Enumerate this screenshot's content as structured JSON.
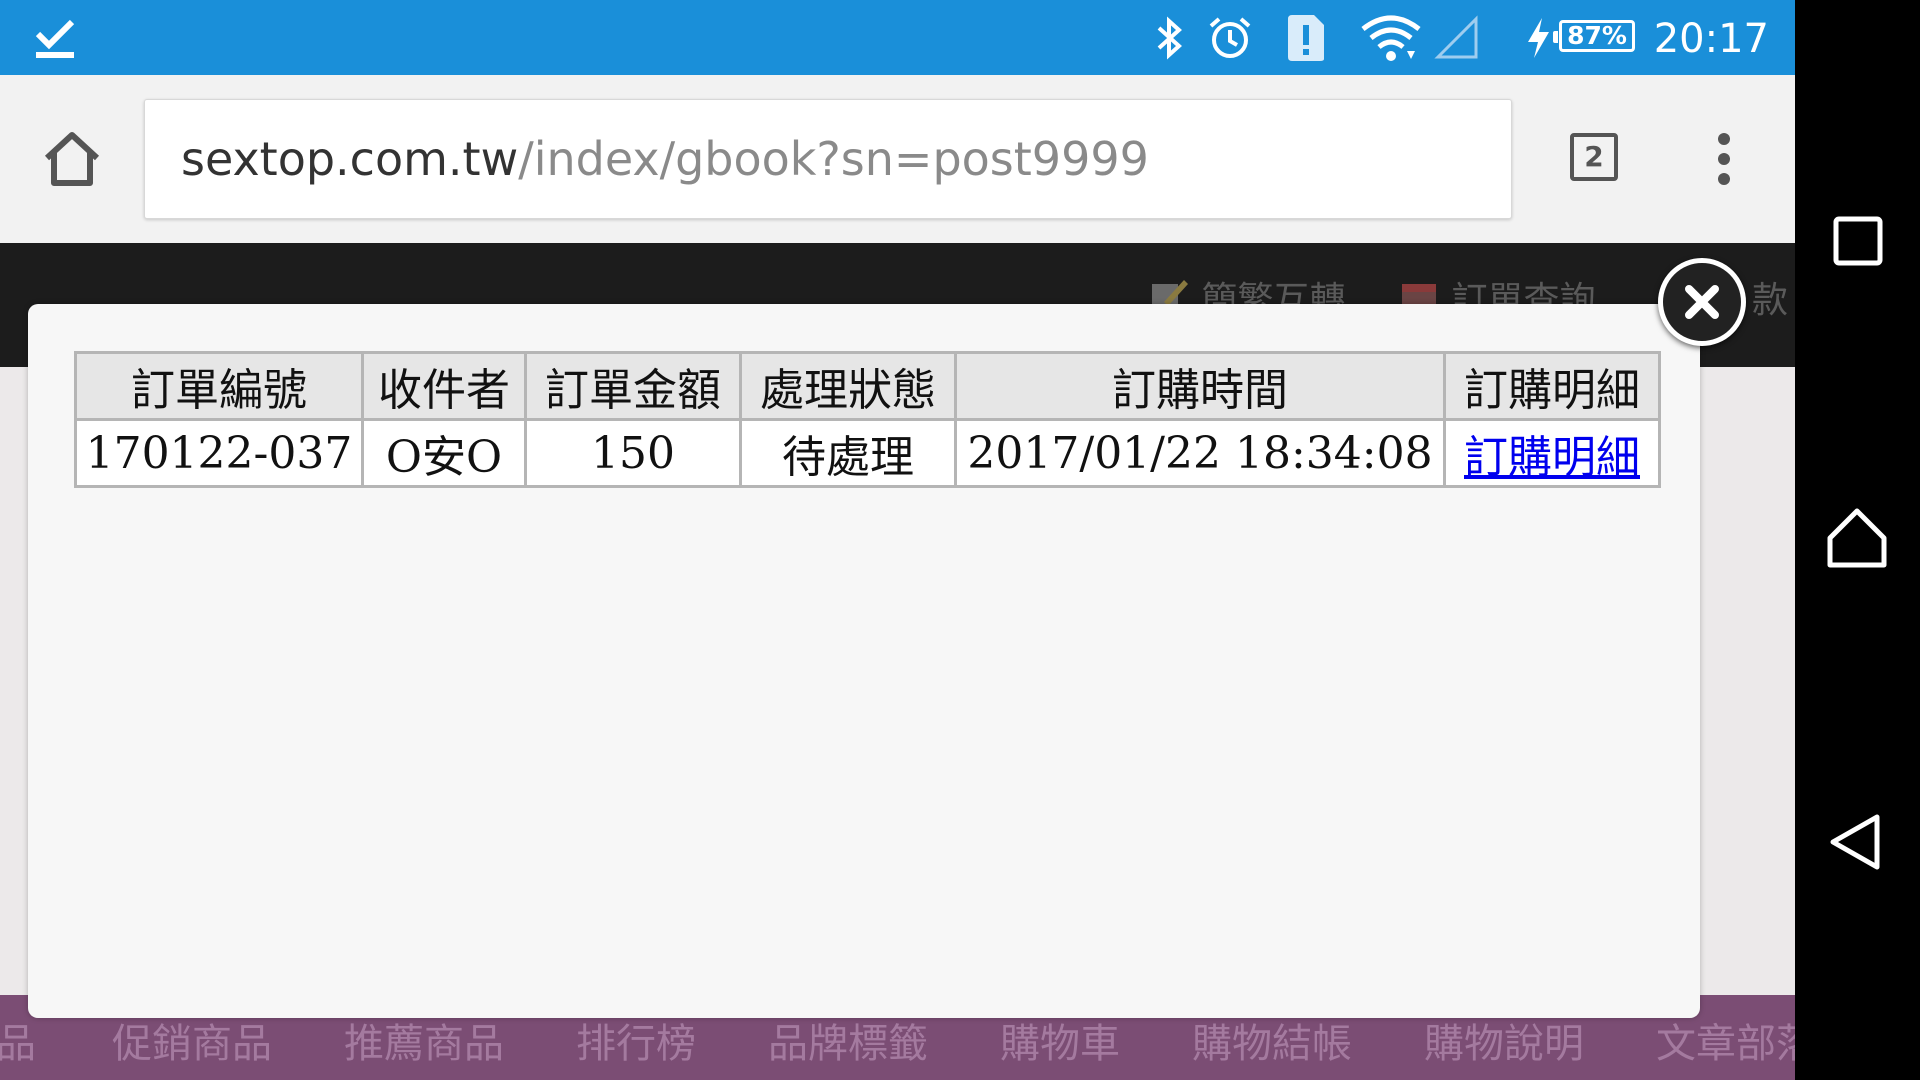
{
  "status_bar": {
    "time": "20:17",
    "battery": "87%",
    "icons": [
      "download-done-icon",
      "bluetooth-icon",
      "alarm-icon",
      "sim-alert-icon",
      "wifi-icon",
      "signal-icon",
      "charging-icon"
    ],
    "color": "#1a8fd9"
  },
  "browser": {
    "url_domain": "sextop.com.tw",
    "url_path": "/index/gbook?sn=post9999",
    "tab_count": "2"
  },
  "page": {
    "top_links": [
      "簡繁互轉",
      "訂單查詢",
      "款"
    ],
    "nav_items": [
      "品",
      "促銷商品",
      "推薦商品",
      "排行榜",
      "品牌標籤",
      "購物車",
      "購物結帳",
      "購物說明",
      "文章部落"
    ],
    "nav_color": "#7b4d74"
  },
  "order_table": {
    "headers": [
      "訂單編號",
      "收件者",
      "訂單金額",
      "處理狀態",
      "訂購時間",
      "訂購明細"
    ],
    "rows": [
      {
        "order_no": "170122-037",
        "recipient": "O安O",
        "amount": "150",
        "status": "待處理",
        "time": "2017/01/22 18:34:08",
        "detail_link": "訂購明細"
      }
    ]
  }
}
